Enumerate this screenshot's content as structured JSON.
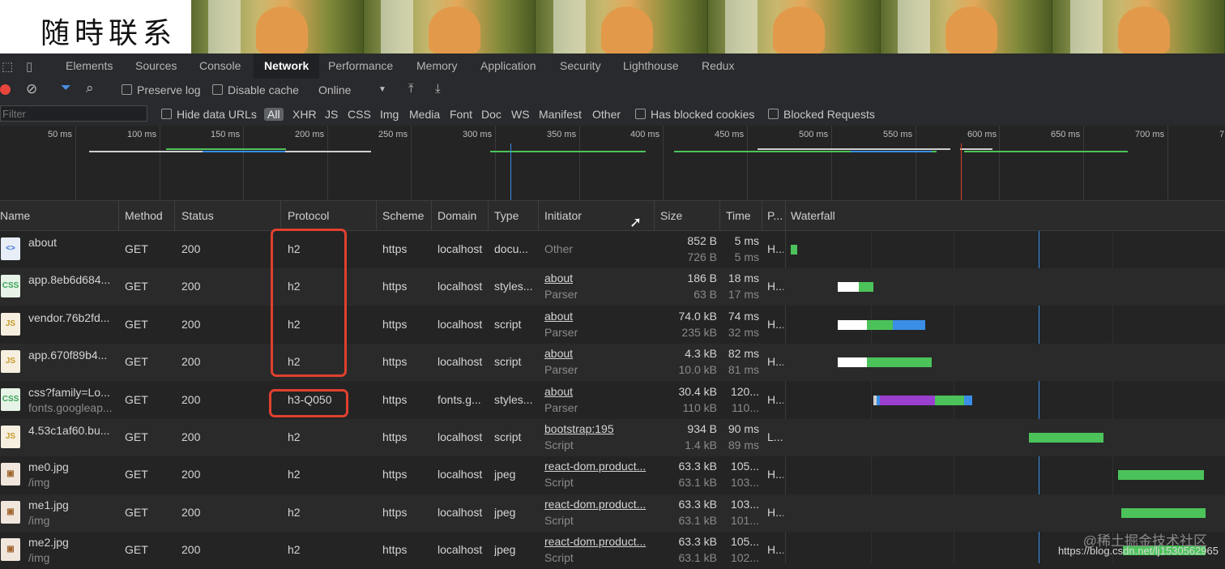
{
  "banner": {
    "title": "随時联系"
  },
  "tabs": [
    "Elements",
    "Sources",
    "Console",
    "Network",
    "Performance",
    "Memory",
    "Application",
    "Security",
    "Lighthouse",
    "Redux"
  ],
  "toolbar": {
    "preserve_log": "Preserve log",
    "disable_cache": "Disable cache",
    "throttle": "Online",
    "throttle_arrow": "▼"
  },
  "filterbar": {
    "placeholder": "Filter",
    "hide_data_urls": "Hide data URLs",
    "types": [
      "All",
      "XHR",
      "JS",
      "CSS",
      "Img",
      "Media",
      "Font",
      "Doc",
      "WS",
      "Manifest",
      "Other"
    ],
    "has_blocked_cookies": "Has blocked cookies",
    "blocked_requests": "Blocked Requests"
  },
  "overview": {
    "ticks": [
      "50 ms",
      "100 ms",
      "150 ms",
      "200 ms",
      "250 ms",
      "300 ms",
      "350 ms",
      "400 ms",
      "450 ms",
      "500 ms",
      "550 ms",
      "600 ms",
      "650 ms",
      "700 ms",
      "7"
    ]
  },
  "columns": {
    "name": "Name",
    "method": "Method",
    "status": "Status",
    "protocol": "Protocol",
    "scheme": "Scheme",
    "domain": "Domain",
    "type": "Type",
    "initiator": "Initiator",
    "size": "Size",
    "time": "Time",
    "priority": "P...",
    "waterfall": "Waterfall"
  },
  "rows": [
    {
      "name": "about",
      "path": "",
      "method": "GET",
      "status": "200",
      "protocol": "h2",
      "scheme": "https",
      "domain": "localhost",
      "type": "docu...",
      "initiator": "Other",
      "initiator_sub": "",
      "size": "852 B",
      "size_sub": "726 B",
      "time": "5 ms",
      "time_sub": "5 ms",
      "priority": "H...",
      "icon": "html"
    },
    {
      "name": "app.8eb6d684...",
      "path": "",
      "method": "GET",
      "status": "200",
      "protocol": "h2",
      "scheme": "https",
      "domain": "localhost",
      "type": "styles...",
      "initiator": "about",
      "initiator_sub": "Parser",
      "size": "186 B",
      "size_sub": "63 B",
      "time": "18 ms",
      "time_sub": "17 ms",
      "priority": "H...",
      "icon": "css"
    },
    {
      "name": "vendor.76b2fd...",
      "path": "",
      "method": "GET",
      "status": "200",
      "protocol": "h2",
      "scheme": "https",
      "domain": "localhost",
      "type": "script",
      "initiator": "about",
      "initiator_sub": "Parser",
      "size": "74.0 kB",
      "size_sub": "235 kB",
      "time": "74 ms",
      "time_sub": "32 ms",
      "priority": "H...",
      "icon": "js"
    },
    {
      "name": "app.670f89b4...",
      "path": "",
      "method": "GET",
      "status": "200",
      "protocol": "h2",
      "scheme": "https",
      "domain": "localhost",
      "type": "script",
      "initiator": "about",
      "initiator_sub": "Parser",
      "size": "4.3 kB",
      "size_sub": "10.0 kB",
      "time": "82 ms",
      "time_sub": "81 ms",
      "priority": "H...",
      "icon": "js"
    },
    {
      "name": "css?family=Lo...",
      "path": "fonts.googleap...",
      "method": "GET",
      "status": "200",
      "protocol": "h3-Q050",
      "scheme": "https",
      "domain": "fonts.g...",
      "type": "styles...",
      "initiator": "about",
      "initiator_sub": "Parser",
      "size": "30.4 kB",
      "size_sub": "110 kB",
      "time": "120...",
      "time_sub": "110...",
      "priority": "H...",
      "icon": "css"
    },
    {
      "name": "4.53c1af60.bu...",
      "path": "",
      "method": "GET",
      "status": "200",
      "protocol": "h2",
      "scheme": "https",
      "domain": "localhost",
      "type": "script",
      "initiator": "bootstrap:195",
      "initiator_sub": "Script",
      "size": "934 B",
      "size_sub": "1.4 kB",
      "time": "90 ms",
      "time_sub": "89 ms",
      "priority": "L...",
      "icon": "js"
    },
    {
      "name": "me0.jpg",
      "path": "/img",
      "method": "GET",
      "status": "200",
      "protocol": "h2",
      "scheme": "https",
      "domain": "localhost",
      "type": "jpeg",
      "initiator": "react-dom.product...",
      "initiator_sub": "Script",
      "size": "63.3 kB",
      "size_sub": "63.1 kB",
      "time": "105...",
      "time_sub": "103...",
      "priority": "H...",
      "icon": "img"
    },
    {
      "name": "me1.jpg",
      "path": "/img",
      "method": "GET",
      "status": "200",
      "protocol": "h2",
      "scheme": "https",
      "domain": "localhost",
      "type": "jpeg",
      "initiator": "react-dom.product...",
      "initiator_sub": "Script",
      "size": "63.3 kB",
      "size_sub": "63.1 kB",
      "time": "103...",
      "time_sub": "101...",
      "priority": "H...",
      "icon": "img"
    },
    {
      "name": "me2.jpg",
      "path": "/img",
      "method": "GET",
      "status": "200",
      "protocol": "h2",
      "scheme": "https",
      "domain": "localhost",
      "type": "jpeg",
      "initiator": "react-dom.product...",
      "initiator_sub": "Script",
      "size": "63.3 kB",
      "size_sub": "63.1 kB",
      "time": "105...",
      "time_sub": "102...",
      "priority": "H...",
      "icon": "img"
    }
  ],
  "watermark": "@稀土掘金技术社区",
  "watermark_url": "https://blog.csdn.net/lj1530562965",
  "colors": {
    "accent_red": "#e0402f",
    "waterfall_green": "#4cc35a",
    "waterfall_blue": "#3a8ee6",
    "waterfall_purple": "#9a3fd0"
  }
}
